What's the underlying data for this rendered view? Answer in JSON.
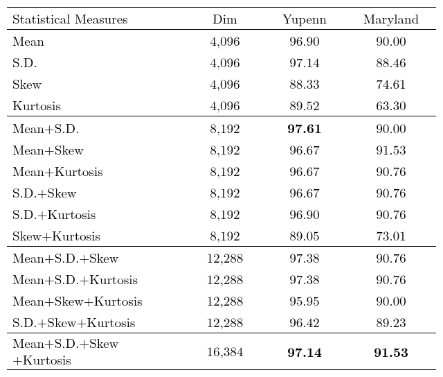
{
  "headers": {
    "measures": "Statistical Measures",
    "dim": "Dim",
    "yupenn": "Yupenn",
    "maryland": "Maryland"
  },
  "groups": [
    {
      "rows": [
        {
          "label": "Mean",
          "dim": "4,096",
          "yupenn": "96.90",
          "maryland": "90.00"
        },
        {
          "label": "S.D.",
          "dim": "4,096",
          "yupenn": "97.14",
          "maryland": "88.46"
        },
        {
          "label": "Skew",
          "dim": "4,096",
          "yupenn": "88.33",
          "maryland": "74.61"
        },
        {
          "label": "Kurtosis",
          "dim": "4,096",
          "yupenn": "89.52",
          "maryland": "63.30"
        }
      ]
    },
    {
      "rows": [
        {
          "label": "Mean+S.D.",
          "dim": "8,192",
          "yupenn": "97.61",
          "maryland": "90.00",
          "bold_yupenn": true
        },
        {
          "label": "Mean+Skew",
          "dim": "8,192",
          "yupenn": "96.67",
          "maryland": "91.53"
        },
        {
          "label": "Mean+Kurtosis",
          "dim": "8,192",
          "yupenn": "96.67",
          "maryland": "90.76"
        },
        {
          "label": "S.D.+Skew",
          "dim": "8,192",
          "yupenn": "96.67",
          "maryland": "90.76"
        },
        {
          "label": "S.D.+Kurtosis",
          "dim": "8,192",
          "yupenn": "96.90",
          "maryland": "90.76"
        },
        {
          "label": "Skew+Kurtosis",
          "dim": "8,192",
          "yupenn": "89.05",
          "maryland": "73.01"
        }
      ]
    },
    {
      "rows": [
        {
          "label": "Mean+S.D.+Skew",
          "dim": "12,288",
          "yupenn": "97.38",
          "maryland": "90.76"
        },
        {
          "label": "Mean+S.D.+Kurtosis",
          "dim": "12,288",
          "yupenn": "97.38",
          "maryland": "90.76"
        },
        {
          "label": "Mean+Skew+Kurtosis",
          "dim": "12,288",
          "yupenn": "95.95",
          "maryland": "90.00"
        },
        {
          "label": "S.D.+Skew+Kurtosis",
          "dim": "12,288",
          "yupenn": "96.42",
          "maryland": "89.23"
        }
      ]
    },
    {
      "rows": [
        {
          "label_line1": "Mean+S.D.+Skew",
          "label_line2": "+Kurtosis",
          "dim": "16,384",
          "yupenn": "97.14",
          "maryland": "91.53",
          "bold_yupenn": true,
          "bold_maryland": true,
          "multiline": true
        }
      ]
    }
  ],
  "chart_data": {
    "type": "table",
    "columns": [
      "Statistical Measures",
      "Dim",
      "Yupenn",
      "Maryland"
    ],
    "rows": [
      [
        "Mean",
        4096,
        96.9,
        90.0
      ],
      [
        "S.D.",
        4096,
        97.14,
        88.46
      ],
      [
        "Skew",
        4096,
        88.33,
        74.61
      ],
      [
        "Kurtosis",
        4096,
        89.52,
        63.3
      ],
      [
        "Mean+S.D.",
        8192,
        97.61,
        90.0
      ],
      [
        "Mean+Skew",
        8192,
        96.67,
        91.53
      ],
      [
        "Mean+Kurtosis",
        8192,
        96.67,
        90.76
      ],
      [
        "S.D.+Skew",
        8192,
        96.67,
        90.76
      ],
      [
        "S.D.+Kurtosis",
        8192,
        96.9,
        90.76
      ],
      [
        "Skew+Kurtosis",
        8192,
        89.05,
        73.01
      ],
      [
        "Mean+S.D.+Skew",
        12288,
        97.38,
        90.76
      ],
      [
        "Mean+S.D.+Kurtosis",
        12288,
        97.38,
        90.76
      ],
      [
        "Mean+Skew+Kurtosis",
        12288,
        95.95,
        90.0
      ],
      [
        "S.D.+Skew+Kurtosis",
        12288,
        96.42,
        89.23
      ],
      [
        "Mean+S.D.+Skew+Kurtosis",
        16384,
        97.14,
        91.53
      ]
    ]
  }
}
